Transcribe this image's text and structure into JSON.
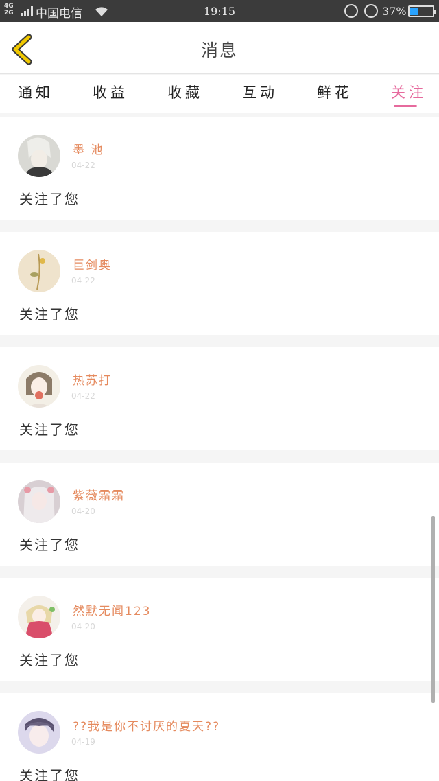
{
  "status_bar": {
    "network": [
      "4G",
      "2G"
    ],
    "carrier": "中国电信",
    "time": "19:15",
    "battery_percent_text": "37%",
    "battery_level": 0.37,
    "icons": [
      "signal-icon",
      "wifi-icon",
      "rotation-lock-icon",
      "alarm-icon",
      "battery-icon"
    ]
  },
  "header": {
    "back_icon": "chevron-left-icon",
    "title": "消息",
    "accent_color": "#f0c800"
  },
  "tabs": [
    {
      "label": "通知",
      "active": false
    },
    {
      "label": "收益",
      "active": false
    },
    {
      "label": "收藏",
      "active": false
    },
    {
      "label": "互动",
      "active": false
    },
    {
      "label": "鲜花",
      "active": false
    },
    {
      "label": "关注",
      "active": true
    }
  ],
  "colors": {
    "active_tab": "#e66a9d",
    "username": "#e58a5e",
    "date": "#d8d8d8",
    "page_bg": "#f5f5f5"
  },
  "notifications": [
    {
      "user": "墨 池",
      "date": "04-22",
      "action": "关注了您"
    },
    {
      "user": "巨剑奥",
      "date": "04-22",
      "action": "关注了您"
    },
    {
      "user": "热苏打",
      "date": "04-22",
      "action": "关注了您"
    },
    {
      "user": "紫薇霜霜",
      "date": "04-20",
      "action": "关注了您"
    },
    {
      "user": "然默无闻123",
      "date": "04-20",
      "action": "关注了您"
    },
    {
      "user": "??我是你不讨厌的夏天??",
      "date": "04-19",
      "action": "关注了您"
    }
  ]
}
